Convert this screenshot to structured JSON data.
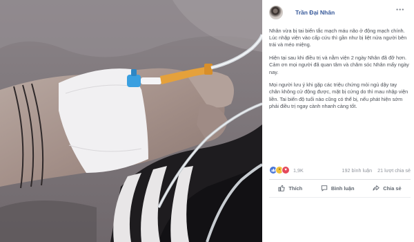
{
  "post": {
    "author": "Trần Đại Nhân",
    "paragraphs": [
      "Nhân vừa bị tai biến tắc mạch máu não ở động mạch chính. Lúc nhập viện vào cấp cứu thì gần như bị liệt nửa người bên trái và méo miệng.",
      "Hiện tại sau khi điều trị và nằm viện 2 ngày Nhân đã đỡ hơn. Cảm ơn mọi người đã quan tâm và chăm sóc Nhân mấy ngày nay.",
      "Mọi người lưu ý khi gặp các triệu chứng mỏi ngủ dậy tay chân không cử động được, mặt bị cứng do thì mau nhập viện liền. Tai biến độ tuổi nào cũng có thể bị, nếu phát hiện sớm phải điều trị ngay cành nhanh càng tốt."
    ],
    "reactions": {
      "icons": [
        "like-icon",
        "sad-icon",
        "love-icon"
      ],
      "count": "1,9K",
      "comments": "192 bình luận",
      "shares": "21 lượt chia sẻ"
    },
    "actions": {
      "like": "Thích",
      "comment": "Bình luận",
      "share": "Chia sẻ"
    },
    "more_icon": "more-options-icon"
  },
  "photo": {
    "icon": "hospital-iv-photo"
  },
  "colors": {
    "author_link": "#365899",
    "body_text": "#4b4f56",
    "meta_text": "#90949c",
    "like_blue": "#4a76d6"
  }
}
